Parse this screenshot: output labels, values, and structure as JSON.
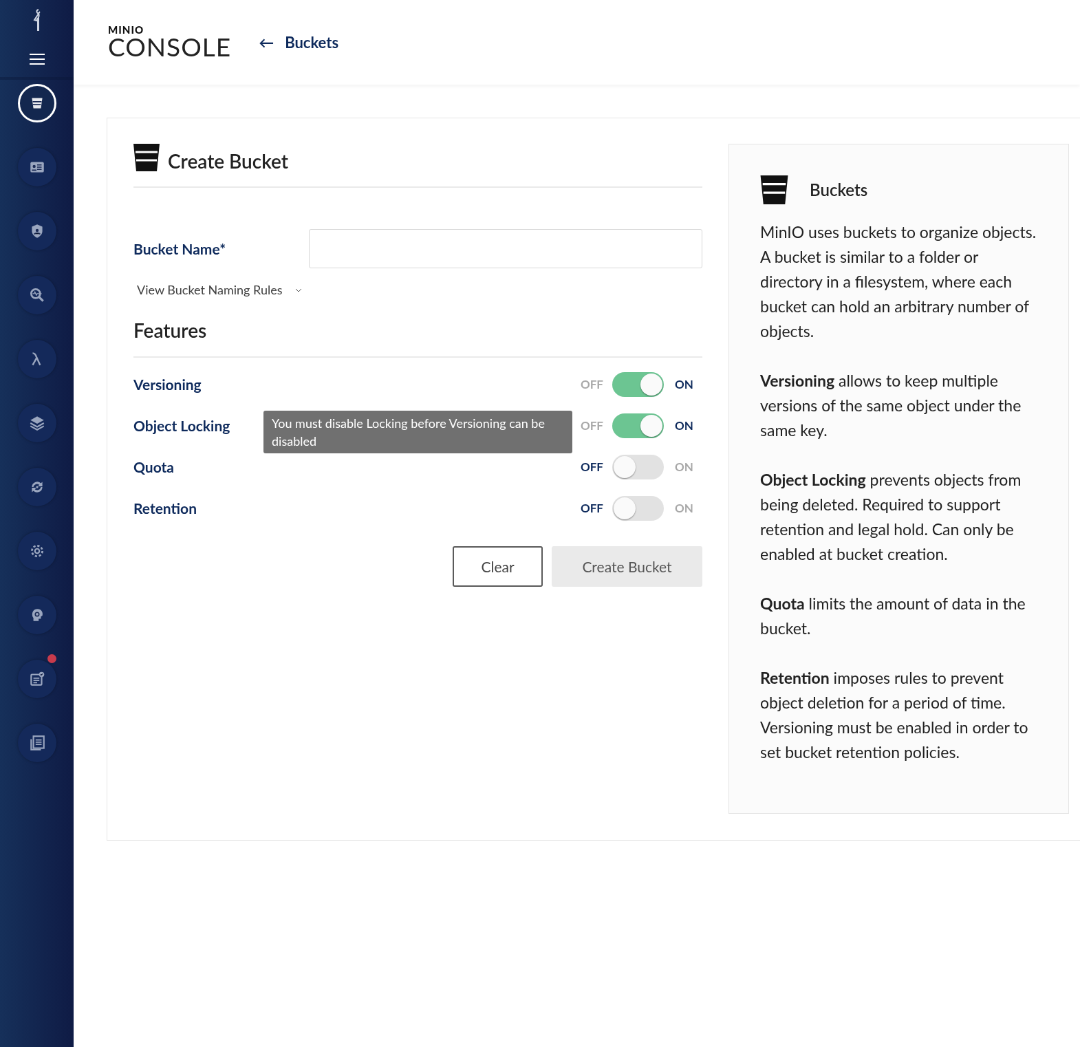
{
  "sidebar": {
    "items": [
      {
        "selected": true,
        "notification": false
      },
      {
        "selected": false,
        "notification": false
      },
      {
        "selected": false,
        "notification": false
      },
      {
        "selected": false,
        "notification": false
      },
      {
        "selected": false,
        "notification": false
      },
      {
        "selected": false,
        "notification": false
      },
      {
        "selected": false,
        "notification": false
      },
      {
        "selected": false,
        "notification": false
      },
      {
        "selected": false,
        "notification": false
      },
      {
        "selected": false,
        "notification": true
      },
      {
        "selected": false,
        "notification": false
      }
    ]
  },
  "header": {
    "logo_top": "MINIO",
    "logo_bottom": "CONSOLE",
    "back_arrow": "←",
    "back_link": "Buckets"
  },
  "form": {
    "title": "Create Bucket",
    "bucket_name_label": "Bucket Name*",
    "naming_rules": "View Bucket Naming Rules",
    "features_title": "Features",
    "features": [
      {
        "label": "Versioning",
        "off_label": "OFF",
        "on_label": "ON",
        "on": true
      },
      {
        "label": "Object Locking",
        "off_label": "OFF",
        "on_label": "ON",
        "on": true
      },
      {
        "label": "Quota",
        "off_label": "OFF",
        "on_label": "ON",
        "on": false
      },
      {
        "label": "Retention",
        "off_label": "OFF",
        "on_label": "ON",
        "on": false
      }
    ],
    "tooltip": "You must disable Locking before Versioning can be disabled",
    "buttons": [
      {
        "label": "Clear",
        "kind": "outline",
        "disabled": false
      },
      {
        "label": "Create Bucket",
        "kind": "primary",
        "disabled": true
      }
    ]
  },
  "help": {
    "title": "Buckets",
    "paragraphs": [
      "MinIO uses buckets to organize objects. A bucket is similar to a folder or directory in a filesystem, where each bucket can hold an arbitrary number of objects.",
      "**Versioning** allows to keep multiple versions of the same object under the same key.",
      "**Object Locking** prevents objects from being deleted. Required to support retention and legal hold. Can only be enabled at bucket creation.",
      "**Quota** limits the amount of data in the bucket.",
      "**Retention** imposes rules to prevent object deletion for a period of time. Versioning must be enabled in order to set bucket retention policies."
    ]
  }
}
